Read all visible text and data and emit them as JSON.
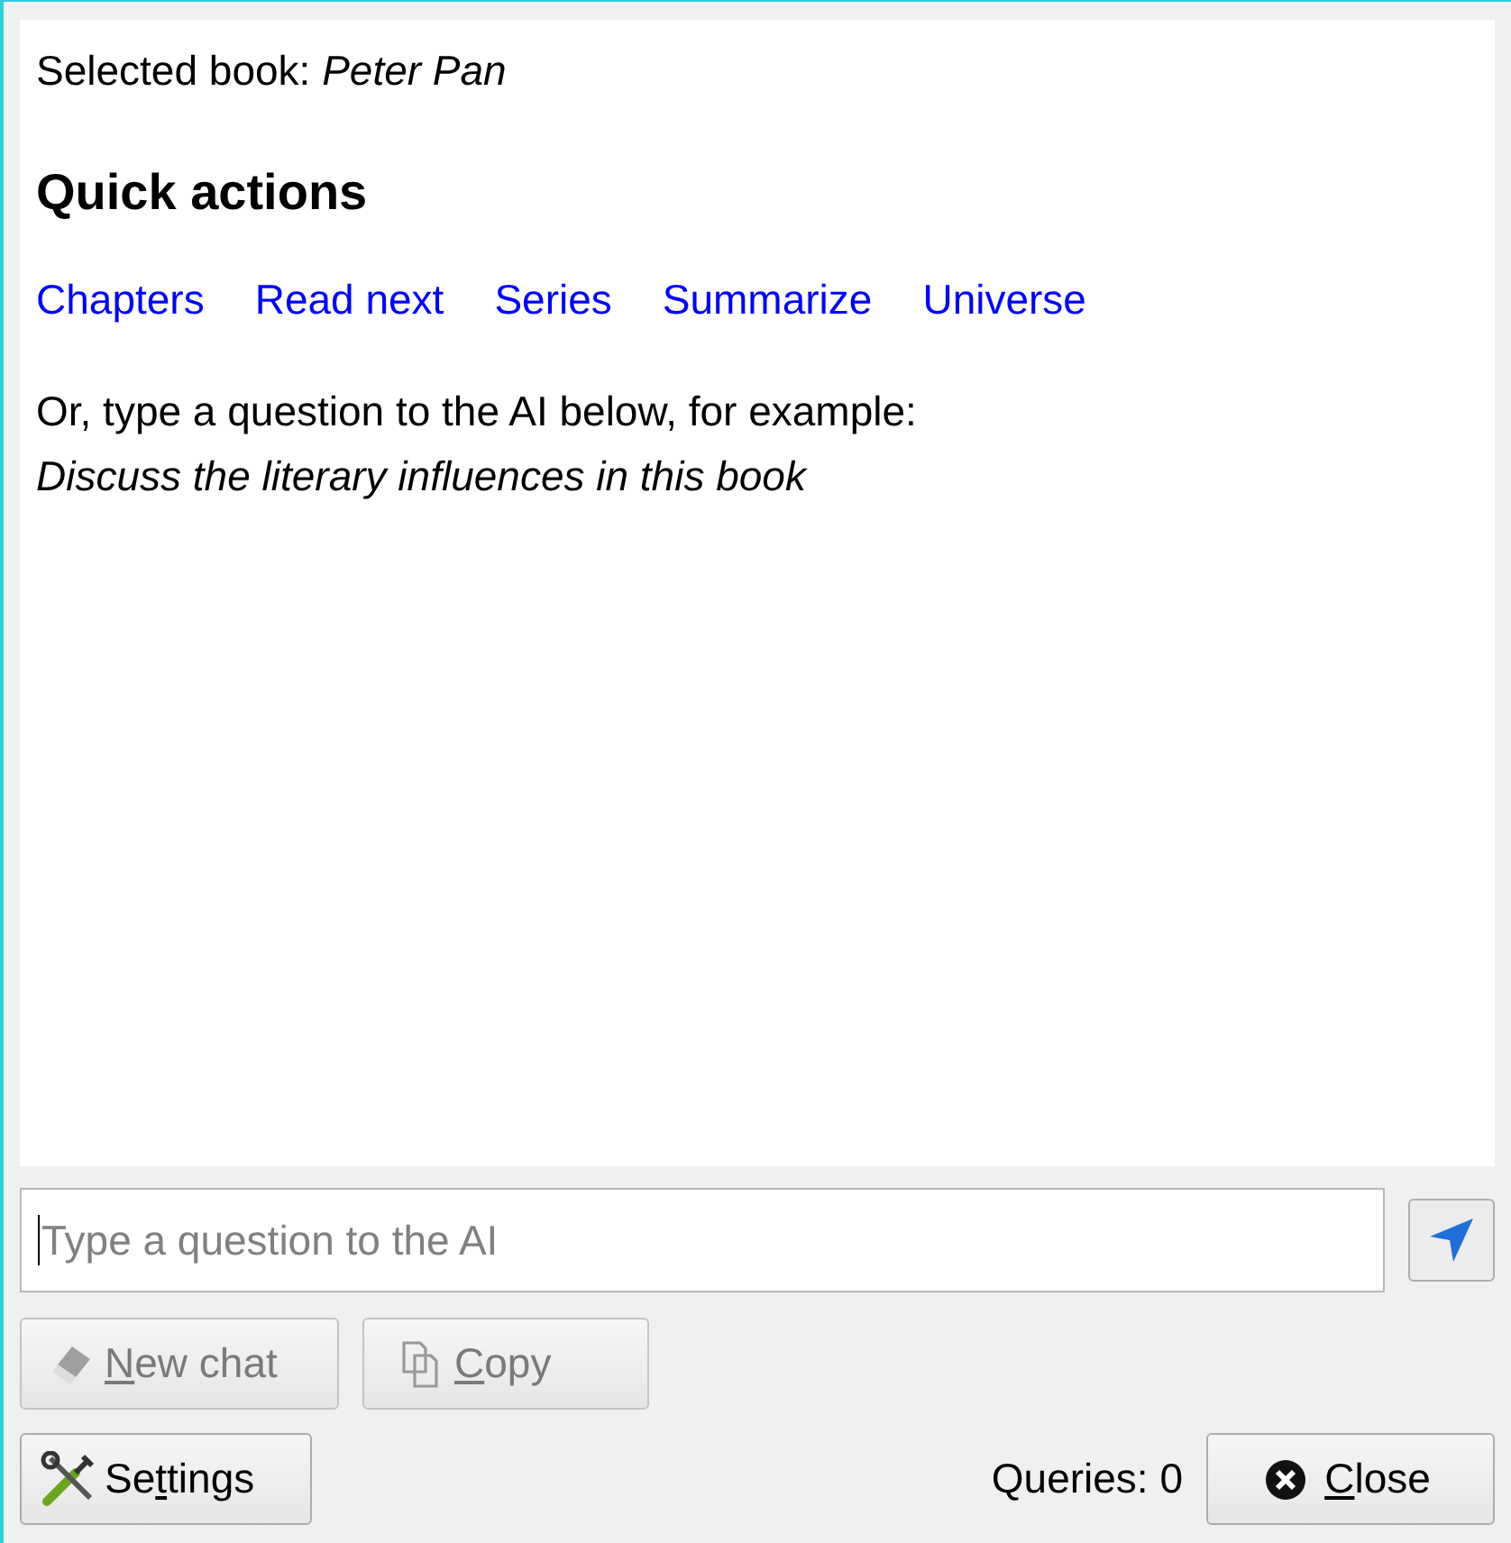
{
  "selected_book": {
    "label": "Selected book:",
    "title": "Peter Pan"
  },
  "quick_actions": {
    "heading": "Quick actions",
    "links": [
      "Chapters",
      "Read next",
      "Series",
      "Summarize",
      "Universe"
    ]
  },
  "hint": {
    "text": "Or, type a question to the AI below, for example:",
    "example": "Discuss the literary influences in this book"
  },
  "question_field": {
    "placeholder": "Type a question to the AI"
  },
  "action_buttons": [
    {
      "kind": "new-chat",
      "label": {
        "key": "N",
        "after": "ew chat"
      },
      "disabled": true
    },
    {
      "kind": "copy",
      "label": {
        "key": "C",
        "after": "opy"
      },
      "disabled": true
    }
  ],
  "settings_button": {
    "label": {
      "before": "Se",
      "key": "t",
      "after": "tings"
    }
  },
  "queries": "Queries: 0",
  "close_button": {
    "label": {
      "key": "C",
      "after": "lose"
    }
  }
}
